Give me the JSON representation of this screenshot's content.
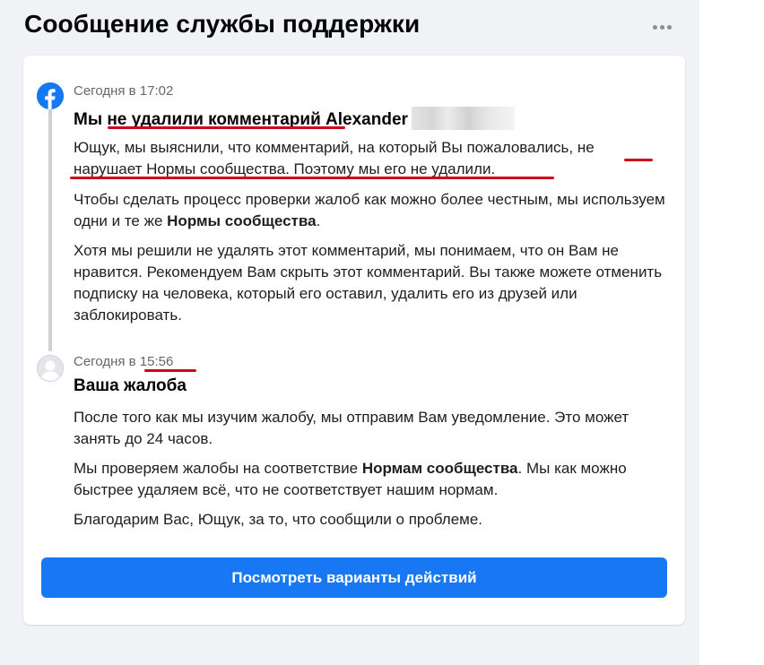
{
  "page": {
    "title": "Сообщение службы поддержки"
  },
  "messages": [
    {
      "timestamp": "Сегодня в 17:02",
      "title_prefix": "Мы не удалили комментарий Alexander",
      "paragraphs": [
        {
          "line1": "Ющук, мы выяснили, что комментарий, на который Вы пожаловались, не",
          "line2": "нарушает Нормы сообщества. Поэтому мы его не удалили."
        },
        {
          "before": "Чтобы сделать процесс проверки жалоб как можно более честным, мы используем одни и те же ",
          "bold": "Нормы сообщества",
          "after": "."
        },
        {
          "text": "Хотя мы решили не удалять этот комментарий, мы понимаем, что он Вам не нравится. Рекомендуем Вам скрыть этот комментарий. Вы также можете отменить подписку на человека, который его оставил, удалить его из друзей или заблокировать."
        }
      ]
    },
    {
      "timestamp_prefix": "Сегодня в ",
      "timestamp_time": "15:56",
      "title": "Ваша жалоба",
      "paragraphs": [
        {
          "text": "После того как мы изучим жалобу, мы отправим Вам уведомление. Это может занять до 24 часов."
        },
        {
          "before": "Мы проверяем жалобы на соответствие ",
          "bold": "Нормам сообщества",
          "after": ". Мы как можно быстрее удаляем всё, что не соответствует нашим нормам."
        },
        {
          "text": "Благодарим Вас, Ющук, за то, что сообщили о проблеме."
        }
      ]
    }
  ],
  "action_button": {
    "label": "Посмотреть варианты действий"
  },
  "colors": {
    "accent": "#1877f2",
    "annotation": "#d0021b",
    "background": "#f0f2f5",
    "card": "#ffffff",
    "muted_text": "#65676b"
  },
  "icons": {
    "menu": "more-horizontal-icon",
    "brand": "facebook-logo-icon",
    "user": "user-avatar-icon"
  }
}
